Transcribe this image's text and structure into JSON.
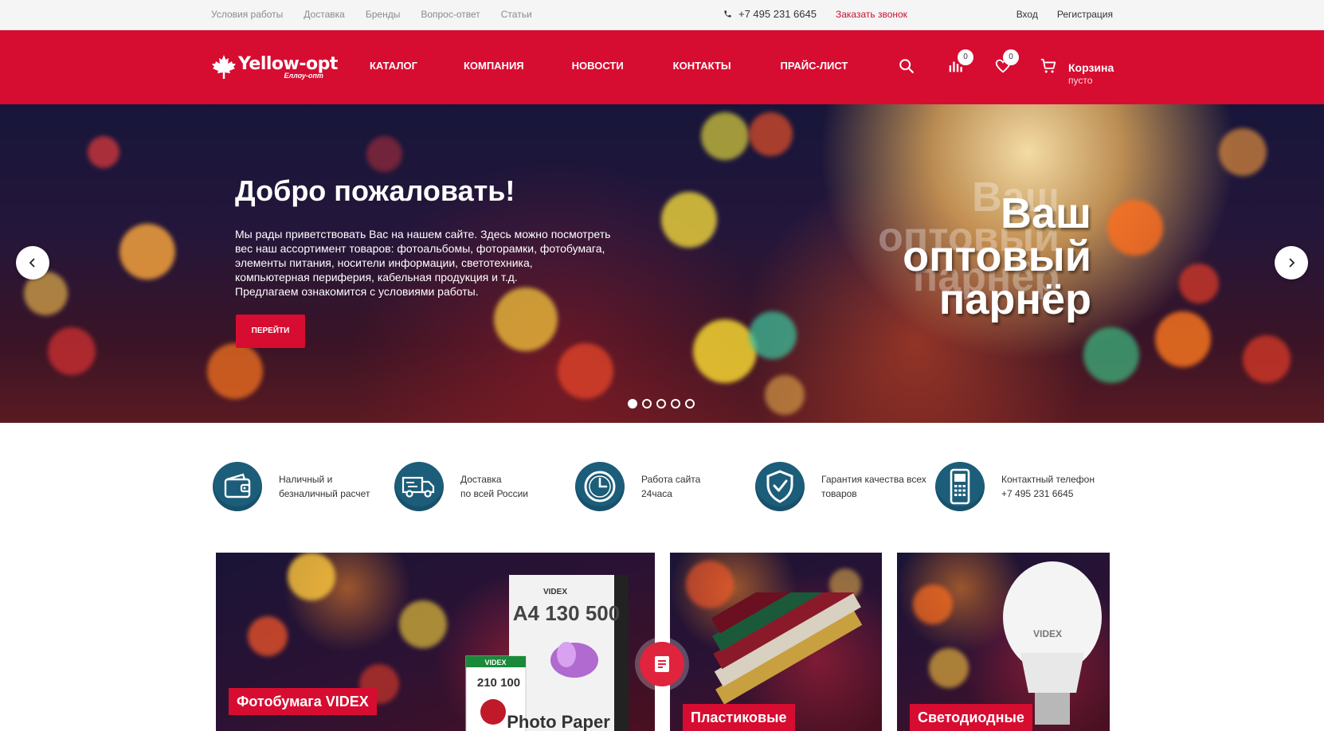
{
  "topbar": {
    "links": [
      "Условия работы",
      "Доставка",
      "Бренды",
      "Вопрос-ответ",
      "Статьи"
    ],
    "phone": "+7 495 231 6645",
    "callback": "Заказать звонок",
    "login": "Вход",
    "register": "Регистрация"
  },
  "header": {
    "logo": {
      "main": "Yellow-opt",
      "sub": "Еллоу-опт"
    },
    "nav": [
      "КАТАЛОГ",
      "КОМПАНИЯ",
      "НОВОСТИ",
      "КОНТАКТЫ",
      "ПРАЙС-ЛИСТ"
    ],
    "compare_count": "0",
    "wishlist_count": "0",
    "cart": {
      "title": "Корзина",
      "status": "пусто"
    }
  },
  "hero": {
    "title": "Добро пожаловать!",
    "intro_lines": [
      "Мы рады приветствовать Вас на нашем сайте. Здесь можно посмотреть",
      "вес наш ассортимент товаров: фотоальбомы, фоторамки, фотобумага,",
      "элементы питания, носители информации, светотехника,",
      "компьютерная периферия, кабельная продукция и т.д.",
      "Предлагаем ознакомится с условиями работы."
    ],
    "button": "ПЕРЕЙТИ",
    "tagline": [
      "Ваш",
      "оптовый",
      "парнёр"
    ],
    "slides": 5,
    "active_slide": 1
  },
  "features": [
    {
      "icon": "wallet-icon",
      "lines": [
        "Наличный и",
        "безналичный расчет"
      ]
    },
    {
      "icon": "truck-icon",
      "lines": [
        "Доставка",
        "по всей России"
      ]
    },
    {
      "icon": "clock-icon",
      "lines": [
        "Работа сайта",
        "24часа"
      ]
    },
    {
      "icon": "shield-check-icon",
      "lines": [
        "Гарантия качества всех",
        "товаров"
      ]
    },
    {
      "icon": "phone-icon",
      "lines": [
        "Контактный телефон",
        "+7 495 231 6645"
      ]
    }
  ],
  "tiles": [
    {
      "label": "Фотобумага VIDEX",
      "product_text": [
        "VIDEX",
        "A4 130 500",
        "VIDEX",
        "210 100",
        "Photo Paper"
      ]
    },
    {
      "label": "Пластиковые"
    },
    {
      "label": "Светодиодные",
      "product_text": [
        "VIDEX"
      ]
    }
  ],
  "colors": {
    "brand_red": "#d70c31",
    "feature_blue": "#1c5d7a"
  }
}
